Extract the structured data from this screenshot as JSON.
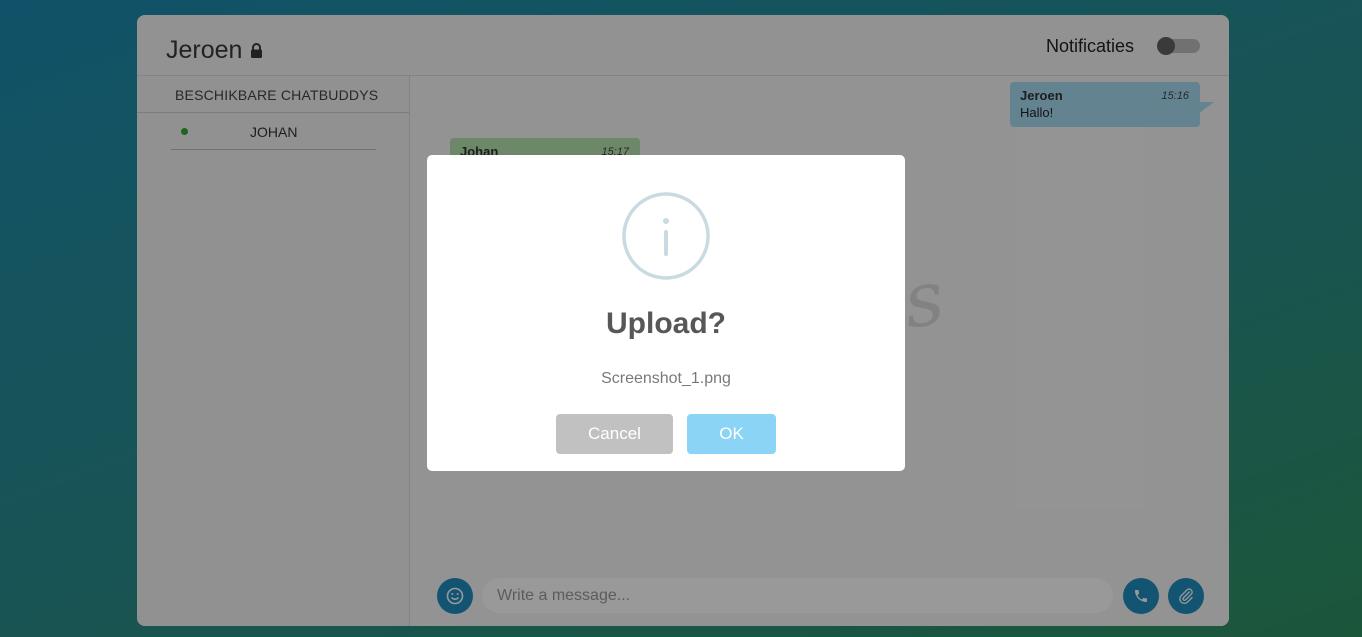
{
  "header": {
    "title": "Jeroen",
    "notifications_label": "Notificaties",
    "notifications_enabled": false
  },
  "sidebar": {
    "heading": "BESCHIKBARE CHATBUDDYS",
    "buddies": [
      {
        "name": "JOHAN",
        "status": "online"
      }
    ]
  },
  "chat": {
    "watermark": "is",
    "messages": [
      {
        "sender": "Jeroen",
        "time": "15:16",
        "text": "Hallo!",
        "direction": "outgoing"
      },
      {
        "sender": "Johan",
        "time": "15:17",
        "text": "",
        "direction": "incoming"
      }
    ],
    "composer": {
      "placeholder": "Write a message...",
      "value": ""
    }
  },
  "dialog": {
    "icon": "info-icon",
    "title": "Upload?",
    "text": "Screenshot_1.png",
    "cancel_label": "Cancel",
    "ok_label": "OK"
  },
  "colors": {
    "accent": "#1f8dbf",
    "online": "#2eaa2e",
    "outgoing_bubble": "#a5dbf1",
    "incoming_bubble": "#b6e3ad",
    "ok_button": "#8cd4f5",
    "cancel_button": "#c1c1c1"
  }
}
